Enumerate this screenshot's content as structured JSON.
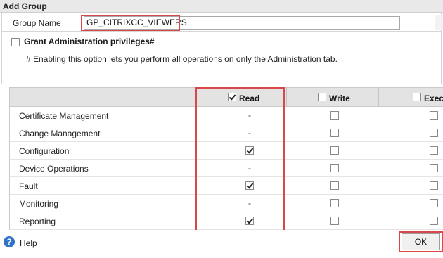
{
  "dialog": {
    "title": "Add Group"
  },
  "form": {
    "group_name_label": "Group Name",
    "group_name_value": "GP_CITRIXCC_VIEWERS",
    "grant_label": "Grant Administration privileges#",
    "grant_checked": false,
    "note": "# Enabling this option lets you perform all operations on only the Administration tab."
  },
  "table": {
    "columns": [
      {
        "label": "Read",
        "checked": true
      },
      {
        "label": "Write",
        "checked": false
      },
      {
        "label": "Exec",
        "checked": false
      }
    ],
    "rows": [
      {
        "label": "Certificate Management",
        "read": "-",
        "write": false,
        "exec": false
      },
      {
        "label": "Change Management",
        "read": "-",
        "write": false,
        "exec": false
      },
      {
        "label": "Configuration",
        "read": true,
        "write": false,
        "exec": false
      },
      {
        "label": "Device Operations",
        "read": "-",
        "write": false,
        "exec": false
      },
      {
        "label": "Fault",
        "read": true,
        "write": false,
        "exec": false
      },
      {
        "label": "Monitoring",
        "read": "-",
        "write": false,
        "exec": false
      },
      {
        "label": "Reporting",
        "read": true,
        "write": false,
        "exec": false
      }
    ]
  },
  "footer": {
    "help_label": "Help",
    "ok_label": "OK"
  },
  "colors": {
    "highlight_border": "#d9474b",
    "help_icon": "#2f73c8"
  },
  "icons": {
    "help": "help-circle-icon"
  }
}
